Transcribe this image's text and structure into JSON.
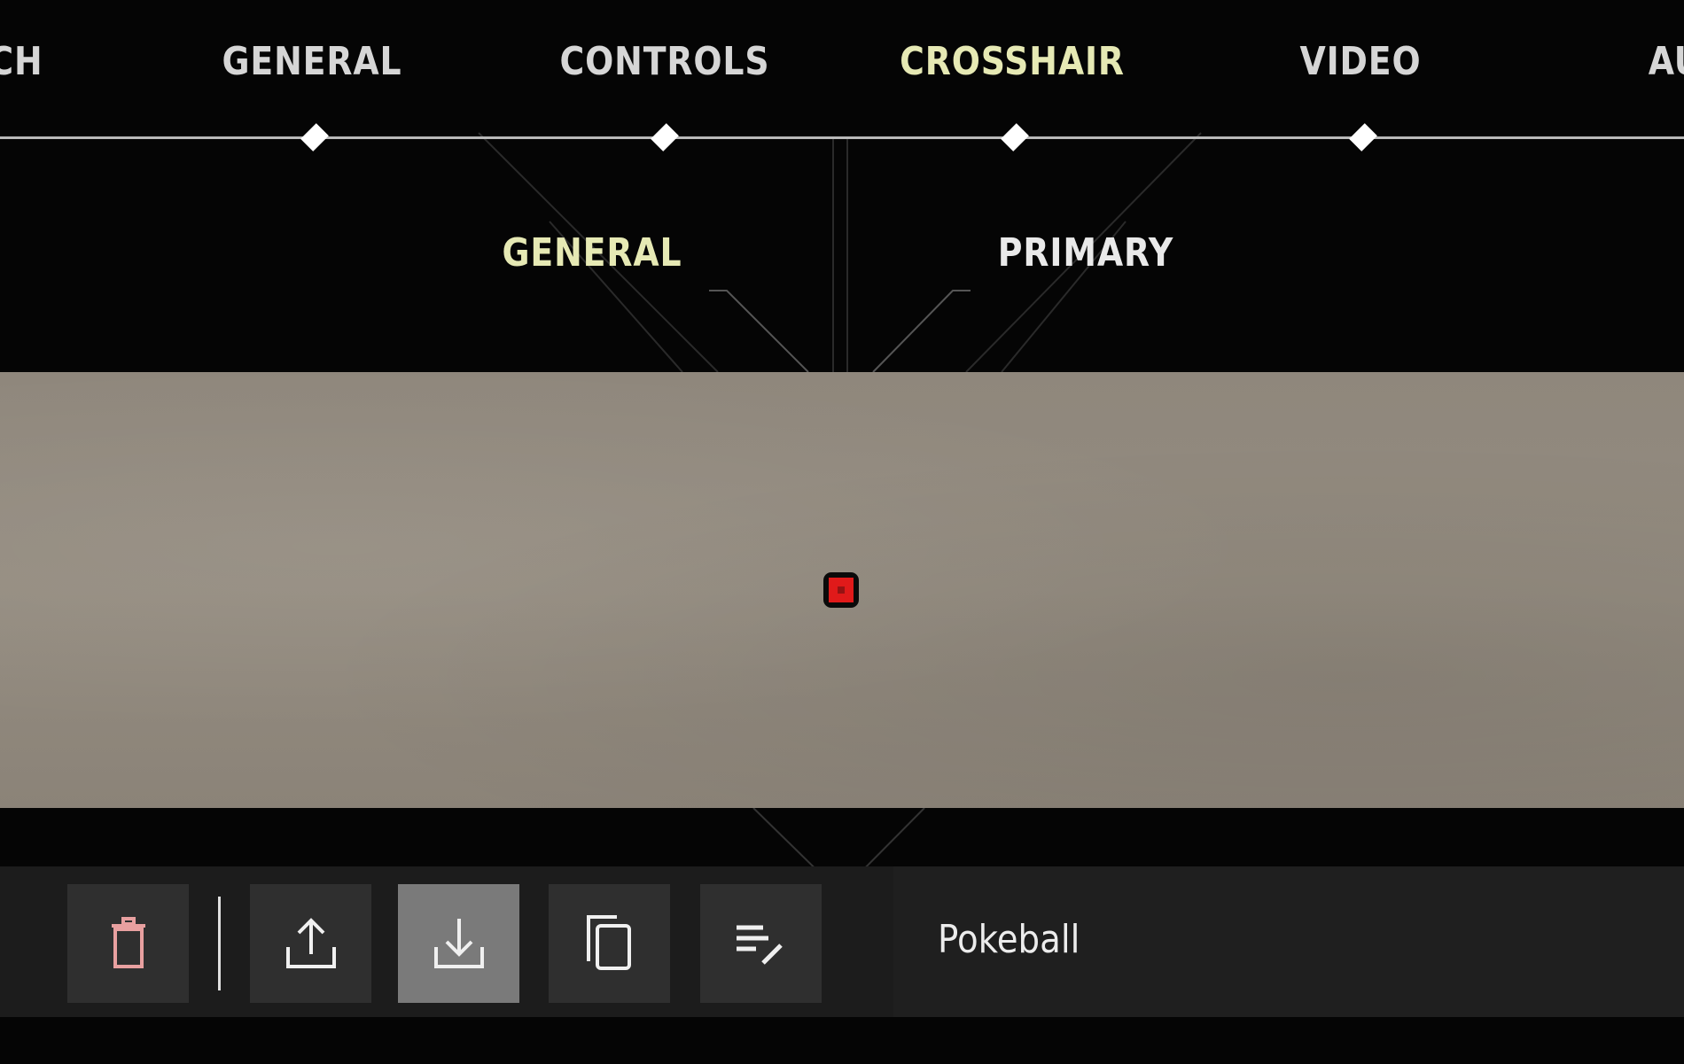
{
  "top_nav": {
    "tabs": [
      {
        "label": "CH",
        "active": false
      },
      {
        "label": "GENERAL",
        "active": false
      },
      {
        "label": "CONTROLS",
        "active": false
      },
      {
        "label": "CROSSHAIR",
        "active": true
      },
      {
        "label": "VIDEO",
        "active": false
      },
      {
        "label": "AU",
        "active": false
      }
    ]
  },
  "sub_nav": {
    "tabs": [
      {
        "label": "GENERAL",
        "active": true
      },
      {
        "label": "PRIMARY",
        "active": false
      }
    ]
  },
  "preview": {
    "crosshair_color": "#e01a1a",
    "crosshair_outline": "#0a0a0a"
  },
  "toolbar": {
    "buttons": [
      {
        "icon": "trash-icon",
        "name": "delete-profile-button"
      },
      {
        "icon": "upload-icon",
        "name": "export-profile-button"
      },
      {
        "icon": "download-icon",
        "name": "import-profile-button",
        "selected": true
      },
      {
        "icon": "copy-icon",
        "name": "duplicate-profile-button"
      },
      {
        "icon": "rename-icon",
        "name": "rename-profile-button"
      }
    ],
    "profile_name": "Pokeball"
  },
  "colors": {
    "active_tab": "#e6e9b4",
    "inactive_tab": "#d6d6d6",
    "delete_icon": "#e8a0a0"
  }
}
